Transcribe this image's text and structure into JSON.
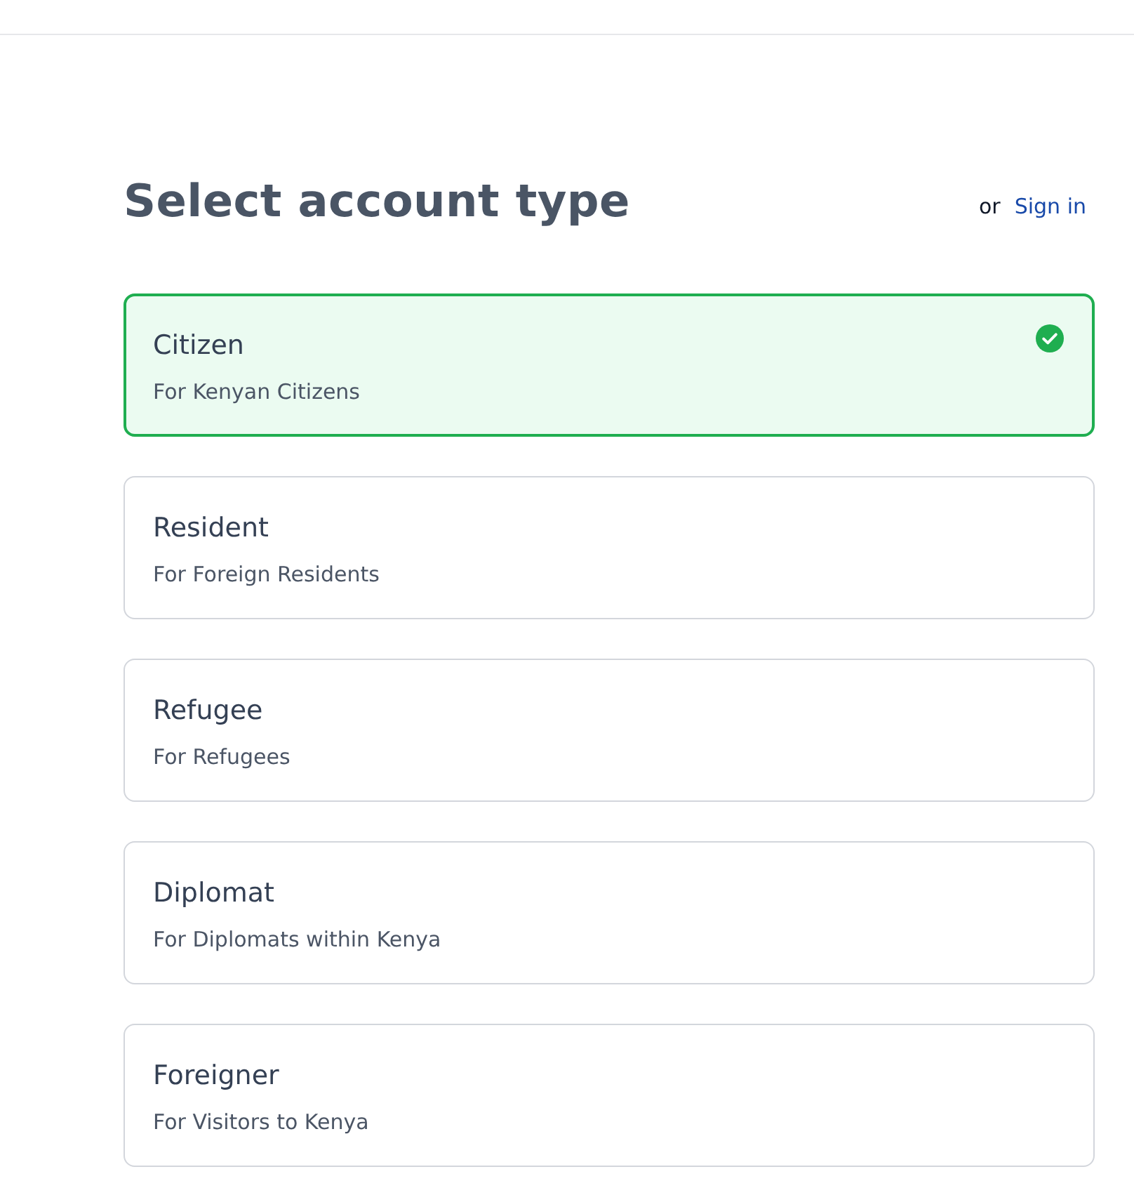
{
  "header": {
    "title": "Select account type",
    "signin_prefix": "or",
    "signin_link": "Sign in"
  },
  "account_types": [
    {
      "title": "Citizen",
      "description": "For Kenyan Citizens",
      "selected": true
    },
    {
      "title": "Resident",
      "description": "For Foreign Residents",
      "selected": false
    },
    {
      "title": "Refugee",
      "description": "For Refugees",
      "selected": false
    },
    {
      "title": "Diplomat",
      "description": "For Diplomats within Kenya",
      "selected": false
    },
    {
      "title": "Foreigner",
      "description": "For Visitors to Kenya",
      "selected": false
    }
  ]
}
